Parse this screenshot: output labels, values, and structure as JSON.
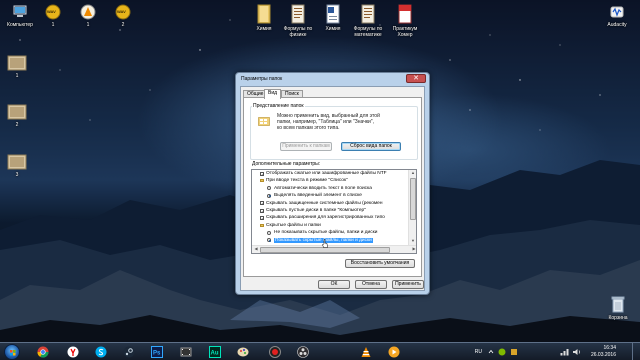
{
  "desktop": {
    "icons": [
      {
        "label": "Компьютер",
        "icon": "computer-icon"
      },
      {
        "label": "1",
        "icon": "wav-file-icon",
        "badge": "WAV"
      },
      {
        "label": "1",
        "icon": "vlc-file-icon"
      },
      {
        "label": "2",
        "icon": "wav-file-icon",
        "badge": "WAV"
      },
      {
        "label": "Химия",
        "icon": "folder-icon"
      },
      {
        "label": "Формулы по физике",
        "icon": "document-image-icon"
      },
      {
        "label": "Химия",
        "icon": "word-document-icon"
      },
      {
        "label": "Формулы по математике",
        "icon": "document-image-icon"
      },
      {
        "label": "Практикум Хомер",
        "icon": "pdf-file-icon"
      },
      {
        "label": "Audacity",
        "icon": "audacity-icon"
      },
      {
        "label": "1",
        "icon": "image-file-icon"
      },
      {
        "label": "2",
        "icon": "image-file-icon"
      },
      {
        "label": "3",
        "icon": "image-file-icon"
      },
      {
        "label": "Корзина",
        "icon": "recycle-bin-icon"
      }
    ]
  },
  "dialog": {
    "title": "Параметры папок",
    "close_symbol": "✕",
    "tabs": [
      {
        "label": "Общие",
        "active": false
      },
      {
        "label": "Вид",
        "active": true
      },
      {
        "label": "Поиск",
        "active": false
      }
    ],
    "folder_views": {
      "legend": "Представление папок",
      "description_lines": [
        "Можно применить вид, выбранный для этой",
        "папки, например, \"Таблица\" или \"Значки\",",
        "ко всем папкам этого типа."
      ],
      "apply_button": "Применить к папкам",
      "reset_button": "Сброс вида папок"
    },
    "advanced_label": "Дополнительные параметры:",
    "tree_items": [
      {
        "kind": "checkbox",
        "level": 1,
        "checked": true,
        "text": "Отображать сжатые или зашифрованные файлы NTF"
      },
      {
        "kind": "folder",
        "level": 1,
        "text": "При вводе текста в режиме \"Список\""
      },
      {
        "kind": "radio",
        "level": 2,
        "checked": false,
        "text": "Автоматически вводить текст в поле поиска"
      },
      {
        "kind": "radio",
        "level": 2,
        "checked": true,
        "text": "Выделять введенный элемент в списке"
      },
      {
        "kind": "checkbox",
        "level": 1,
        "checked": true,
        "text": "Скрывать защищенные системные файлы (рекомен"
      },
      {
        "kind": "checkbox",
        "level": 1,
        "checked": true,
        "text": "Скрывать пустые диски в папке \"Компьютер\""
      },
      {
        "kind": "checkbox",
        "level": 1,
        "checked": true,
        "text": "Скрывать расширения для зарегистрированных типо"
      },
      {
        "kind": "folder",
        "level": 1,
        "text": "Скрытые файлы и папки"
      },
      {
        "kind": "radio",
        "level": 2,
        "checked": false,
        "text": "Не показывать скрытые файлы, папки и диски"
      },
      {
        "kind": "radio",
        "level": 2,
        "checked": true,
        "selected": true,
        "text": "Показывать скрытые файлы, папки и диски"
      }
    ],
    "restore_button": "Восстановить умолчания",
    "ok_button": "ОК",
    "cancel_button": "Отмена",
    "apply_button": "Применить"
  },
  "taskbar": {
    "apps": [
      "chrome-icon",
      "yandex-icon",
      "skype-icon",
      "steam-icon",
      "photoshop-icon",
      "film-icon",
      "audition-icon",
      "paint-icon",
      "record-icon",
      "obs-icon",
      "vlc-icon",
      "media-player-icon"
    ],
    "language": "RU",
    "time": "16:34",
    "date": "26.03.2016",
    "colors": {
      "photoshop": "#2a3a8a",
      "audition": "#0e4a3a",
      "chrome": "#db4437",
      "skype": "#00aff0"
    }
  }
}
